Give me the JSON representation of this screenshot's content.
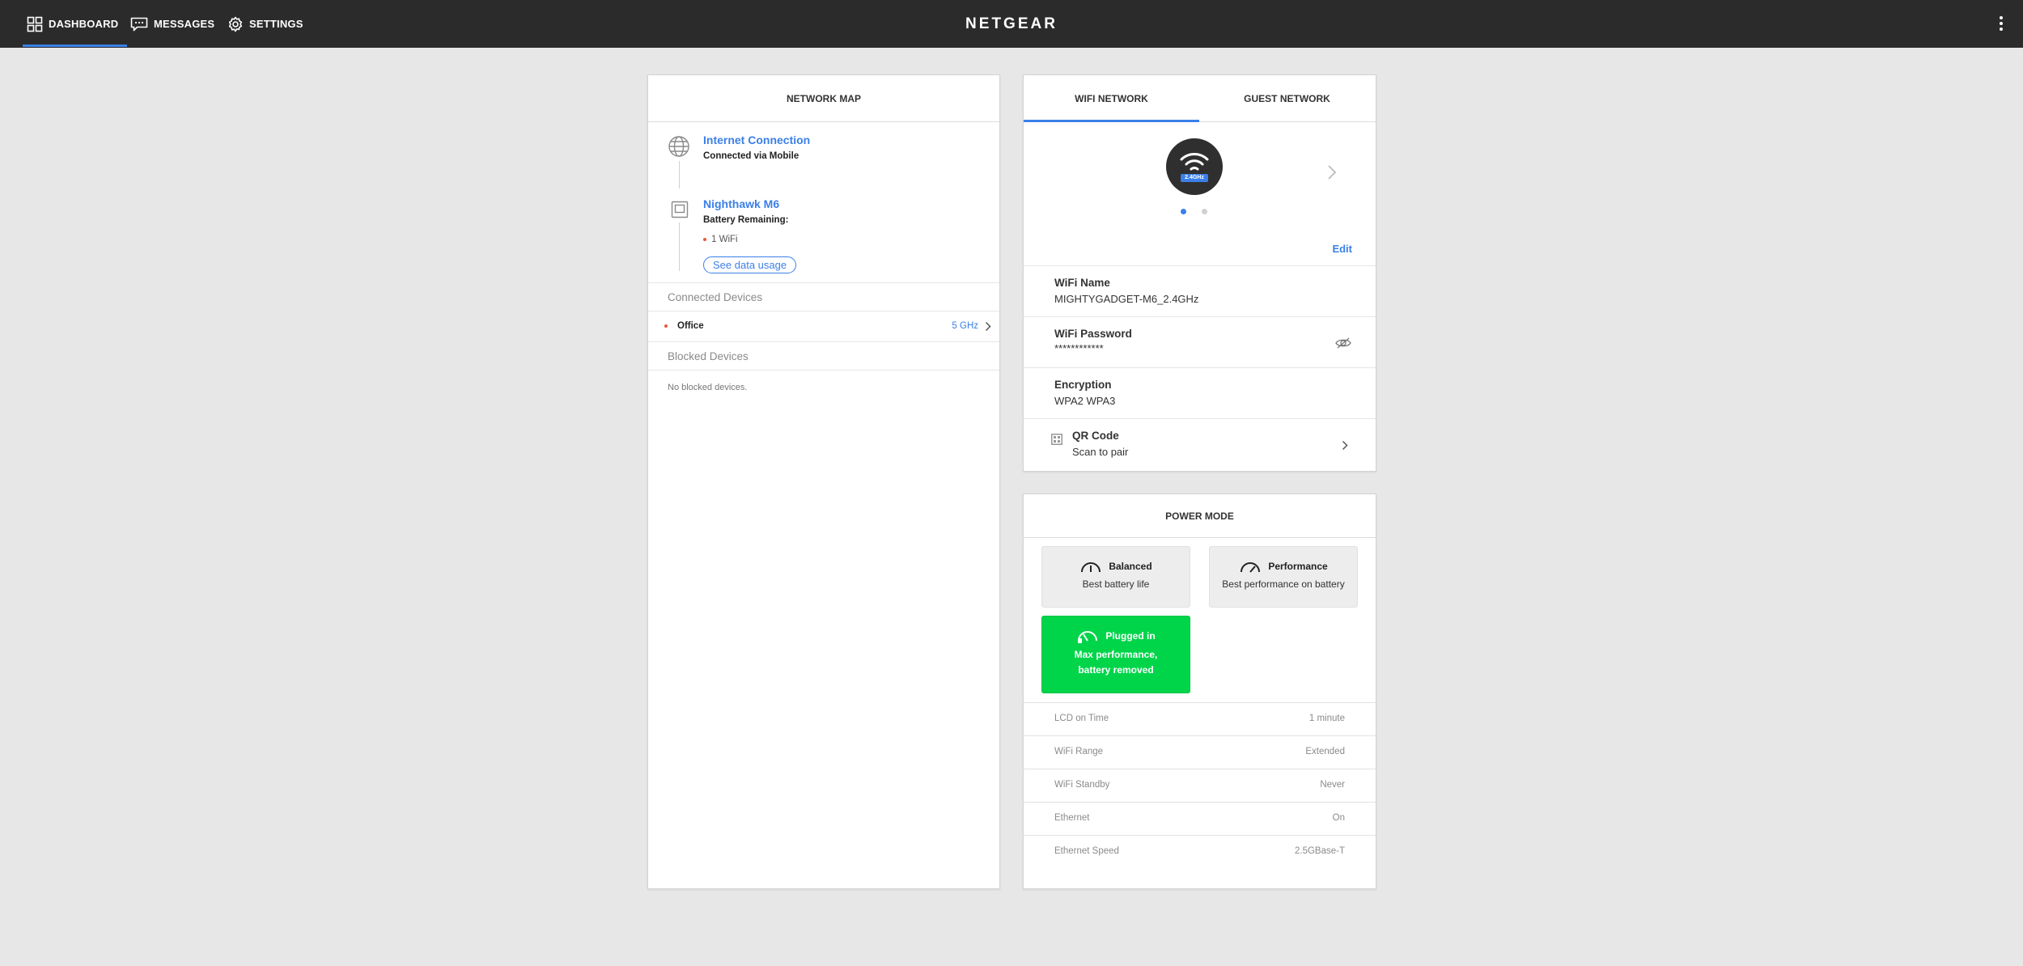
{
  "nav": {
    "dashboard": "DASHBOARD",
    "messages": "MESSAGES",
    "settings": "SETTINGS",
    "brand": "NETGEAR",
    "active_color": "#3b7fe8"
  },
  "network_map": {
    "title": "NETWORK MAP",
    "internet": {
      "title": "Internet Connection",
      "subtitle": "Connected via Mobile",
      "icon": "globe-icon"
    },
    "device": {
      "title": "Nighthawk M6",
      "battery_label": "Battery Remaining:",
      "wifi_count": "1 WiFi",
      "icon": "router-icon"
    },
    "data_usage_button": "See data usage",
    "connected_label": "Connected Devices",
    "connected_devices": [
      {
        "name": "Office",
        "band": "5 GHz"
      }
    ],
    "blocked_label": "Blocked Devices",
    "blocked_empty": "No blocked devices."
  },
  "wifi": {
    "tabs": [
      "WIFI NETWORK",
      "GUEST NETWORK"
    ],
    "active_tab": 0,
    "band_badge": "2.4GHz",
    "carousel_pages": 2,
    "carousel_active": 0,
    "edit_label": "Edit",
    "fields": [
      {
        "label": "WiFi Name",
        "value": "MIGHTYGADGET-M6_2.4GHz"
      },
      {
        "label": "WiFi Password",
        "value": "************"
      },
      {
        "label": "Encryption",
        "value": "WPA2 WPA3"
      }
    ],
    "qr": {
      "label": "QR Code",
      "value": "Scan to pair"
    }
  },
  "power": {
    "title": "POWER MODE",
    "modes": [
      {
        "name": "Balanced",
        "desc": "Best battery life",
        "active": false
      },
      {
        "name": "Performance",
        "desc": "Best performance on battery",
        "active": false
      },
      {
        "name": "Plugged in",
        "desc": "Max performance, battery removed",
        "active": true
      }
    ],
    "active_color": "#00d54a",
    "settings": [
      {
        "key": "LCD on Time",
        "value": "1 minute"
      },
      {
        "key": "WiFi Range",
        "value": "Extended"
      },
      {
        "key": "WiFi Standby",
        "value": "Never"
      },
      {
        "key": "Ethernet",
        "value": "On"
      },
      {
        "key": "Ethernet Speed",
        "value": "2.5GBase-T"
      }
    ]
  }
}
